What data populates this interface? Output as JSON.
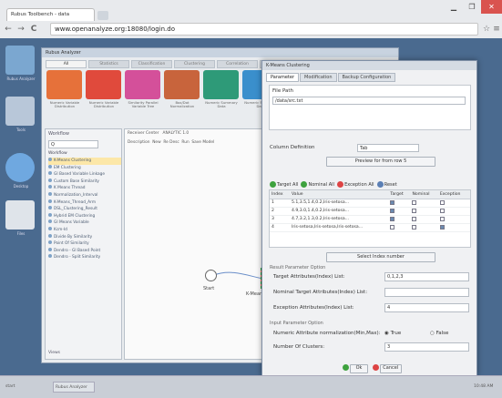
{
  "browser": {
    "tab_title": "Rubus Toolbench - data",
    "url": "www.openanalyze.org:18080/login.do",
    "min": "▁",
    "max": "❐",
    "close": "✕",
    "back": "←",
    "forward": "→",
    "reload": "C"
  },
  "desktop": {
    "icons": [
      "Rubus Analyzer",
      "Tools",
      "Desktop",
      "Files"
    ]
  },
  "app": {
    "title": "Rubus Analyzer",
    "tabs": [
      "All",
      "Statistics",
      "Classification",
      "Clustering",
      "Correlation",
      "Vis"
    ],
    "selected_tab": 0,
    "tools": [
      {
        "label": "Numeric Variable Distribution",
        "color": "#e6713a"
      },
      {
        "label": "Numeric Variable Distribution",
        "color": "#e04a3c"
      },
      {
        "label": "Similarity Parallel Variable Tree",
        "color": "#d4509a"
      },
      {
        "label": "Box/Dot Normalization",
        "color": "#c8643c"
      },
      {
        "label": "Numeric Summary Data",
        "color": "#2e9a78"
      },
      {
        "label": "Numeric Summary Data",
        "color": "#3a8fcc"
      }
    ]
  },
  "workflow": {
    "title": "Workflow",
    "search": "Q",
    "root": "Workflow",
    "items": [
      "K-Means Clustering",
      "EM Clustering",
      "GI Based Variable Linkage",
      "Custom Base Similarity",
      "K Means Thread",
      "Normalization_Interval",
      "K-Means_Thread_Arm",
      "DSL_Clustering_Result",
      "Hybrid EM Clustering",
      "GI Means Variable",
      "Kcm-Id",
      "Divide By Similarity",
      "Point Of Similarity",
      "Dendro - GI Based Point",
      "Dendro - Split Similarity"
    ],
    "tabs_label": "Views"
  },
  "canvas": {
    "toolbar": [
      "Receiver Center",
      "ANALYTIC 1.0",
      "Description",
      "New",
      "Re Desc",
      "Run",
      "Save Model"
    ],
    "start_label": "Start",
    "node_label": "K-Means Clustering"
  },
  "dialog": {
    "title": "K-Means Clustering",
    "tabs": [
      "Parameter",
      "Modification",
      "Backup Configuration"
    ],
    "path_label": "File Path",
    "path_value": "/data/src.txt",
    "column_def_label": "Column Definition",
    "column_def_value": "Tab",
    "preview_button": "Preview for from row 5",
    "actions": [
      "Target All",
      "Nominal All",
      "Exception All",
      "Reset"
    ],
    "columns": [
      "Index",
      "Value",
      "Target",
      "Nominal",
      "Exception"
    ],
    "rows": [
      {
        "index": "1",
        "value": "5.1,3.5,1.4,0.2,Iris-setosa...",
        "target": true,
        "nominal": false,
        "exception": false
      },
      {
        "index": "2",
        "value": "4.9,3.0,1.4,0.2,Iris-setosa...",
        "target": true,
        "nominal": false,
        "exception": false
      },
      {
        "index": "3",
        "value": "4.7,3.2,1.3,0.2,Iris-setosa...",
        "target": true,
        "nominal": false,
        "exception": false
      },
      {
        "index": "4",
        "value": "Iris-setosa,Iris-setosa,Iris-setosa...",
        "target": false,
        "nominal": false,
        "exception": true
      }
    ],
    "select_row_button": "Select Index number",
    "params_group": "Result Parameter Option",
    "target_label": "Target Attributes(Index) List:",
    "target_value": "0,1,2,3",
    "nominal_label": "Nominal Target Attributes(Index) List:",
    "nominal_value": "",
    "exception_label": "Exception Attributes(Index) List:",
    "exception_value": "4",
    "input_group": "Input Parameter Option",
    "normalize_label": "Numeric Attribute normalization(Min,Max):",
    "opt_true": "True",
    "opt_false": "False",
    "clusters_label": "Number Of Clusters:",
    "clusters_value": "3",
    "ok": "Ok",
    "cancel": "Cancel"
  },
  "taskbar": {
    "start": "start",
    "item": "Rubus Analyzer",
    "time": "10:48 AM"
  }
}
